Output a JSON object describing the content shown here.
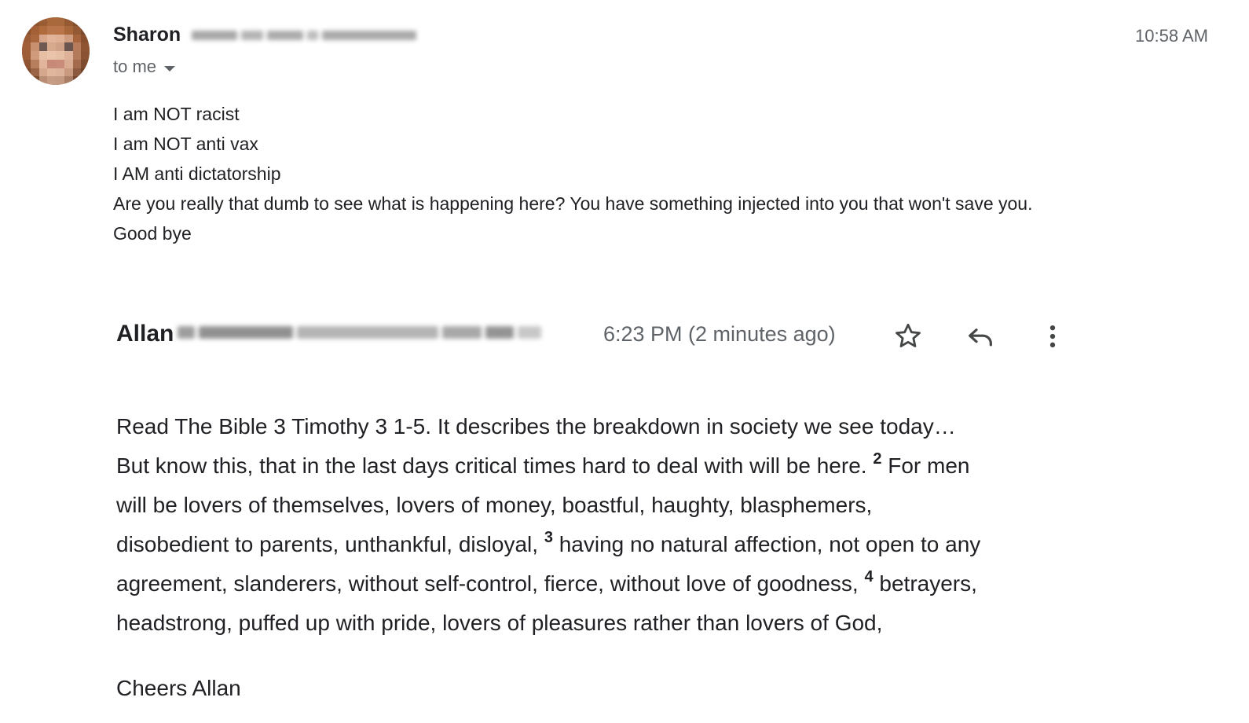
{
  "message1": {
    "sender_name": "Sharon",
    "to_label": "to me",
    "time": "10:58 AM",
    "body_lines": [
      "I am NOT racist",
      "I am NOT anti vax",
      "I AM anti dictatorship",
      "Are you really that dumb to see what is happening here? You have something injected into you that won't save you.",
      "Good bye"
    ]
  },
  "message2": {
    "sender_name": "Allan",
    "time": "6:23 PM (2 minutes ago)",
    "icons": [
      "star-icon",
      "reply-icon",
      "more-vert-icon"
    ],
    "body": {
      "line1": "Read The Bible 3 Timothy 3  1-5. It describes the breakdown in society we see today…",
      "line2_a": "But know this, that in the last days critical times hard to deal with will be here.",
      "verse2": "2",
      "line2_b": "For men",
      "line3": "will be lovers of themselves, lovers of money, boastful, haughty, blasphemers,",
      "line4_a": "disobedient to parents, unthankful, disloyal,",
      "verse3": "3",
      "line4_b": "having no natural affection, not open to any",
      "line5_a": "agreement, slanderers, without self-control, fierce, without love of goodness,",
      "verse4": "4",
      "line5_b": "betrayers,",
      "line6": "headstrong, puffed up with pride, lovers of pleasures rather than lovers of God,"
    },
    "signoff": "Cheers Allan"
  },
  "colors": {
    "text": "#202124",
    "secondary_text": "#5f6368",
    "icon": "#444746"
  }
}
